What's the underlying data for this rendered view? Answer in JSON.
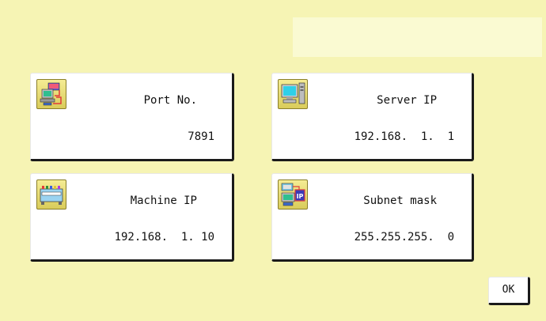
{
  "cards": {
    "port": {
      "label": "Port No.",
      "value": "7891",
      "icon": "network-computer-icon"
    },
    "server": {
      "label": "Server IP",
      "value": "192.168.  1.  1",
      "icon": "computer-icon"
    },
    "machine": {
      "label": "Machine IP",
      "value": "192.168.  1. 10",
      "icon": "embroidery-machine-icon"
    },
    "subnet": {
      "label": "Subnet mask",
      "value": "255.255.255.  0",
      "icon": "ip-network-icon"
    }
  },
  "ok_label": "OK",
  "colors": {
    "background": "#f6f4b4",
    "icon_background": "#e8dd78",
    "card": "#ffffff"
  }
}
